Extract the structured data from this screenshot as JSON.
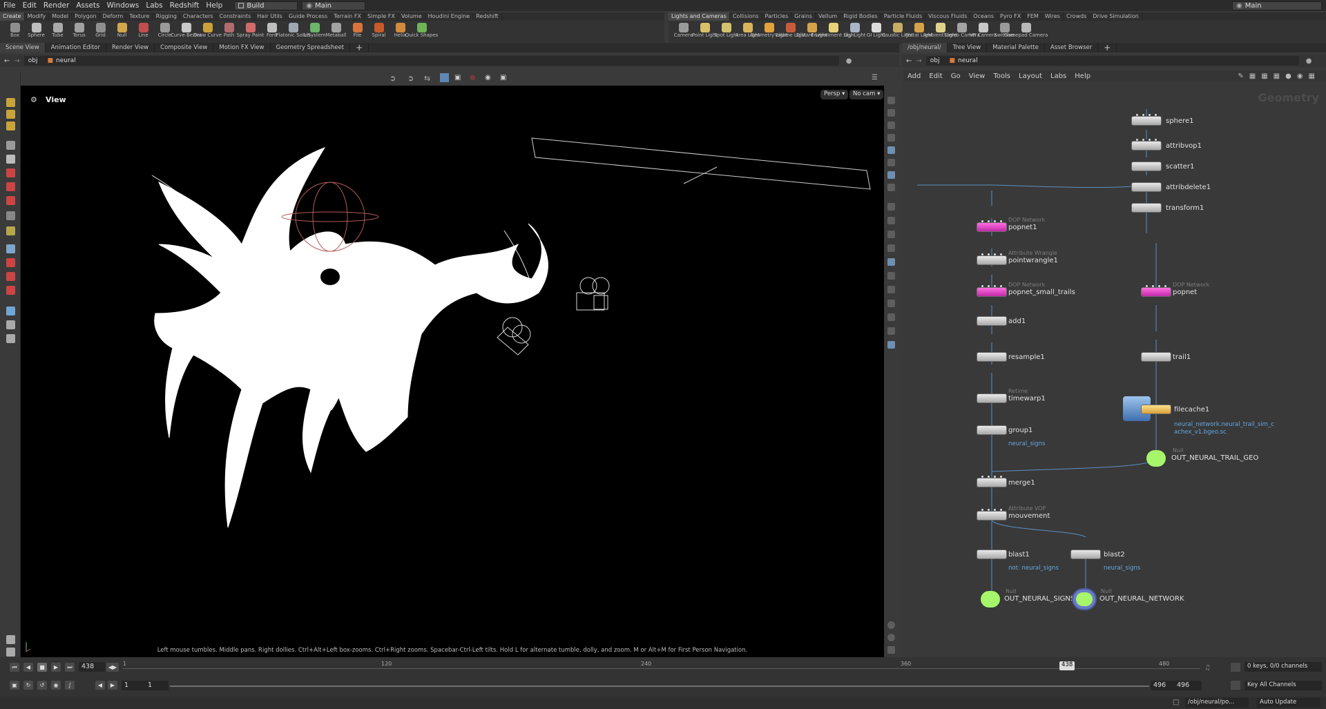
{
  "menubar": {
    "items": [
      "File",
      "Edit",
      "Render",
      "Assets",
      "Windows",
      "Labs",
      "Redshift",
      "Help"
    ],
    "desktop": "Build",
    "context": "Main",
    "right_context": "Main"
  },
  "shelf_left": {
    "tabs": [
      "Create",
      "Modify",
      "Model",
      "Polygon",
      "Deform",
      "Texture",
      "Rigging",
      "Characters",
      "Constraints",
      "Hair Utils",
      "Guide Process",
      "Terrain FX",
      "Simple FX",
      "Volume",
      "Houdini Engine",
      "Redshift"
    ],
    "tools": [
      "Box",
      "Sphere",
      "Tube",
      "Torus",
      "Grid",
      "Null",
      "Line",
      "Circle",
      "Curve Bezier",
      "Draw Curve",
      "Path",
      "Spray Paint",
      "Font",
      "Platonic Solids",
      "L-System",
      "Metaball",
      "File",
      "Spiral",
      "Helix",
      "Quick Shapes"
    ]
  },
  "shelf_right": {
    "tabs": [
      "Lights and Cameras",
      "Collisions",
      "Particles",
      "Grains",
      "Vellum",
      "Rigid Bodies",
      "Particle Fluids",
      "Viscous Fluids",
      "Oceans",
      "Pyro FX",
      "FEM",
      "Wires",
      "Crowds",
      "Drive Simulation"
    ],
    "tools": [
      "Camera",
      "Point Light",
      "Spot Light",
      "Area Light",
      "Geometry Light",
      "Volume Light",
      "Distant Light",
      "Environment Light",
      "Sky Light",
      "GI Light",
      "Caustic Light",
      "Portal Light",
      "Ambient Light",
      "Stereo Camera",
      "VR Camera",
      "Switcher",
      "Gamepad Camera"
    ]
  },
  "left_panetabs": [
    "Scene View",
    "Animation Editor",
    "Render View",
    "Composite View",
    "Motion FX View",
    "Geometry Spreadsheet"
  ],
  "right_panetabs": [
    "/obj/neural/",
    "Tree View",
    "Material Palette",
    "Asset Browser"
  ],
  "left_path": {
    "obj": "obj",
    "node": "neural"
  },
  "right_path": {
    "obj": "obj",
    "node": "neural"
  },
  "viewport": {
    "title": "View",
    "persp": "Persp ▾",
    "cam": "No cam ▾",
    "hint": "Left mouse tumbles. Middle pans. Right dollies. Ctrl+Alt+Left box-zooms. Ctrl+Right zooms. Spacebar-Ctrl-Left tilts. Hold L for alternate tumble, dolly, and zoom. M or Alt+M for First Person Navigation."
  },
  "network": {
    "menu": [
      "Add",
      "Edit",
      "Go",
      "View",
      "Tools",
      "Layout",
      "Labs",
      "Help"
    ],
    "context_label": "Geometry",
    "nodes": {
      "sphere1": "sphere1",
      "attribvop1": "attribvop1",
      "scatter1": "scatter1",
      "attribdelete1": "attribdelete1",
      "transform1": "transform1",
      "popnet1": {
        "type": "DOP Network",
        "name": "popnet1"
      },
      "pointwrangle1": {
        "type": "Attribute Wrangle",
        "name": "pointwrangle1"
      },
      "popnet_small_trails": {
        "type": "DOP Network",
        "name": "popnet_small_trails"
      },
      "popnet": {
        "type": "DOP Network",
        "name": "popnet"
      },
      "add1": "add1",
      "resample1": "resample1",
      "trail1": "trail1",
      "timewarp1": {
        "type": "Retime",
        "name": "timewarp1"
      },
      "filecache1": {
        "name": "filecache1",
        "file": "neural_network.neural_trail_sim_c\nachex_v1.bgeo.sc"
      },
      "group1": {
        "name": "group1",
        "sub": "neural_signs"
      },
      "out_trail": {
        "type": "Null",
        "name": "OUT_NEURAL_TRAIL_GEO"
      },
      "merge1": "merge1",
      "mouvement": {
        "type": "Attribute VOP",
        "name": "mouvement"
      },
      "blast1": {
        "name": "blast1",
        "sub": "not: neural_signs"
      },
      "blast2": {
        "name": "blast2",
        "sub": "neural_signs"
      },
      "out_signs": {
        "type": "Null",
        "name": "OUT_NEURAL_SIGNS"
      },
      "out_network": {
        "type": "Null",
        "name": "OUT_NEURAL_NETWORK"
      }
    }
  },
  "timeline": {
    "current_frame": "438",
    "ticks": [
      "1",
      "120",
      "240",
      "360",
      "480"
    ],
    "marker": "438",
    "start": "1",
    "start2": "1",
    "end1": "496",
    "end2": "496",
    "keys": "0 keys, 0/0 channels",
    "key_all": "Key All Channels",
    "status_path": "/obj/neural/po...",
    "auto_update": "Auto Update"
  },
  "colors": {
    "pink_node": "#e93fc9",
    "link": "#5b8fc4",
    "sub_text": "#64a8e4",
    "null_green": "#a6f56a"
  }
}
